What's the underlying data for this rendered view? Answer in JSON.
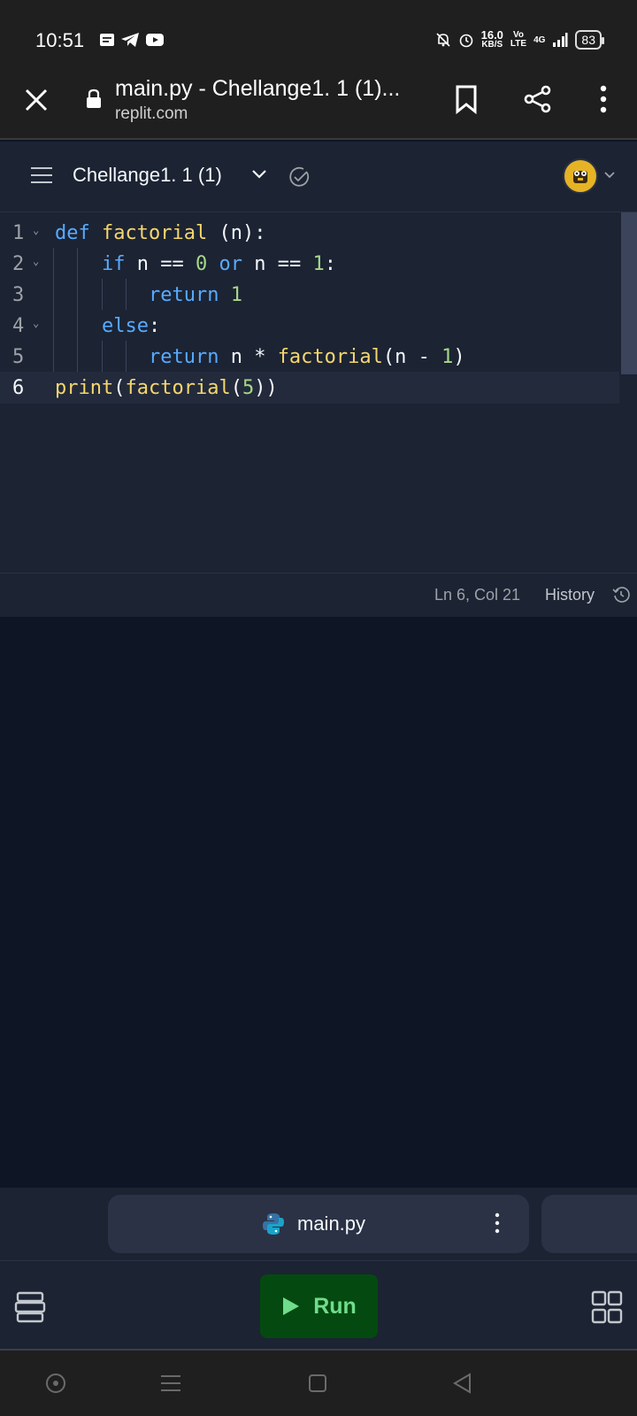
{
  "status_bar": {
    "time": "10:51",
    "net_speed_value": "16.0",
    "net_speed_unit": "KB/S",
    "volte": "Vo\nLTE",
    "network": "4G",
    "battery": "83"
  },
  "browser": {
    "title": "main.py - Chellange1. 1 (1)...",
    "domain": "replit.com"
  },
  "repl": {
    "name": "Chellange1. 1 (1)"
  },
  "editor": {
    "lines": [
      {
        "number": "1"
      },
      {
        "number": "2"
      },
      {
        "number": "3"
      },
      {
        "number": "4"
      },
      {
        "number": "5"
      },
      {
        "number": "6"
      }
    ],
    "tokens": {
      "l1_def": "def",
      "l1_fn": "factorial",
      "l1_rest": " (n):",
      "l2_if": "if",
      "l2_a": " n == ",
      "l2_zero": "0",
      "l2_or": "or",
      "l2_b": " n == ",
      "l2_one": "1",
      "l2_colon": ":",
      "l3_return": "return",
      "l3_one": "1",
      "l4_else": "else",
      "l4_colon": ":",
      "l5_return": "return",
      "l5_a": " n * ",
      "l5_fn": "factorial",
      "l5_b": "(n - ",
      "l5_one": "1",
      "l5_c": ")",
      "l6_print": "print",
      "l6_a": "(",
      "l6_fn": "factorial",
      "l6_b": "(",
      "l6_five": "5",
      "l6_c": "))"
    }
  },
  "editor_status": {
    "cursor": "Ln 6, Col 21",
    "history": "History"
  },
  "file_tab": {
    "label": "main.py"
  },
  "toolbar": {
    "run_label": "Run"
  },
  "colors": {
    "editor_bg": "#1c2333",
    "output_bg": "#0e1525",
    "keyword": "#57abff",
    "function": "#f5d76e",
    "number": "#a7d788",
    "run_bg": "#044a10",
    "run_text": "#6fdd8b"
  }
}
